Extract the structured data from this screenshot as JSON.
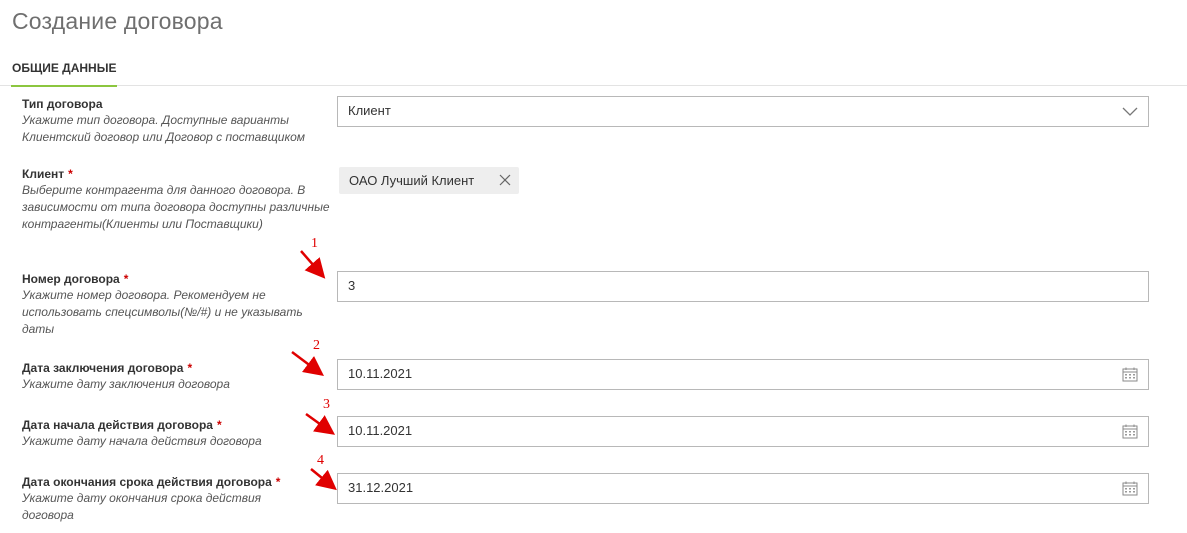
{
  "page": {
    "title": "Создание договора"
  },
  "tabs": {
    "active_label": "ОБЩИЕ ДАННЫЕ"
  },
  "fields": {
    "contract_type": {
      "label": "Тип договора",
      "hint": "Укажите тип договора. Доступные варианты Клиентский договор или Договор с поставщиком",
      "value": "Клиент",
      "icon": "chevron-down-icon"
    },
    "client": {
      "label": "Клиент",
      "required_mark": "*",
      "hint": "Выберите контрагента для данного договора. В зависимости от типа договора доступны различные контрагенты(Клиенты или Поставщики)",
      "value": "ОАО Лучший Клиент",
      "icon": "close-icon"
    },
    "contract_number": {
      "label": "Номер договора",
      "required_mark": "*",
      "hint": "Укажите номер договора. Рекомендуем не использовать спецсимволы(№/#) и не указывать даты",
      "value": "3"
    },
    "conclusion_date": {
      "label": "Дата заключения договора",
      "required_mark": "*",
      "hint": "Укажите дату заключения договора",
      "value": "10.11.2021",
      "icon": "calendar-icon"
    },
    "start_date": {
      "label": "Дата начала действия договора",
      "required_mark": "*",
      "hint": "Укажите дату начала действия договора",
      "value": "10.11.2021",
      "icon": "calendar-icon"
    },
    "end_date": {
      "label": "Дата окончания срока действия договора",
      "required_mark": "*",
      "hint": "Укажите дату окончания срока действия договора",
      "value": "31.12.2021",
      "icon": "calendar-icon"
    }
  },
  "annotations": [
    "1",
    "2",
    "3",
    "4"
  ],
  "colors": {
    "accent_tab_underline": "#8cc63f",
    "required": "#cc0000",
    "annotation": "#e00000"
  }
}
